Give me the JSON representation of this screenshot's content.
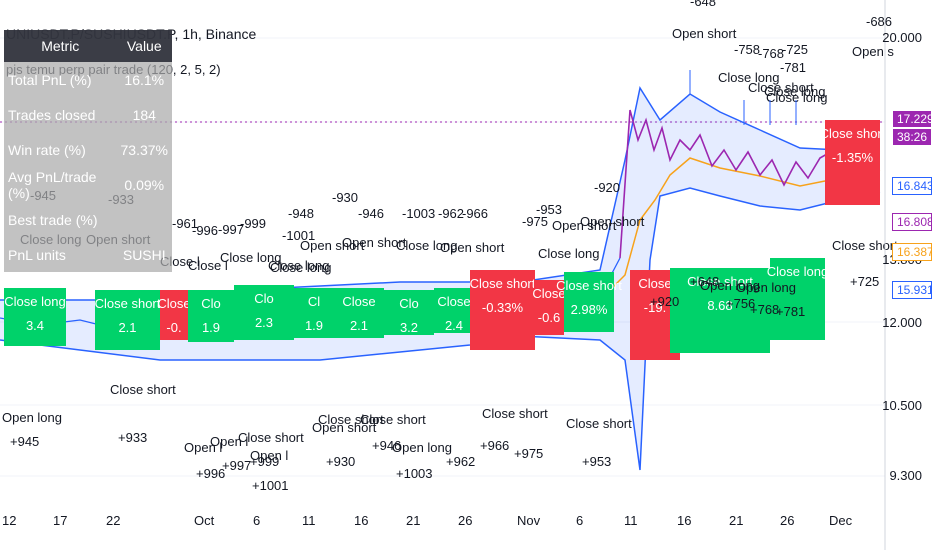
{
  "header": {
    "symbol": "UNIUSDT.P/SUSHIUSDT.P, 1h, Binance",
    "study": "pjs temu perp pair trade (120, 2, 5, 2)"
  },
  "metrics_table": {
    "headers": [
      "Metric",
      "Value"
    ],
    "rows": [
      [
        "Total PnL (%)",
        "16.1%"
      ],
      [
        "Trades closed",
        "184"
      ],
      [
        "Win rate (%)",
        "73.37%"
      ],
      [
        "Avg PnL/trade (%)",
        "0.09%"
      ],
      [
        "Best trade (%)",
        ""
      ],
      [
        "PnL units",
        "SUSHI"
      ]
    ]
  },
  "colors": {
    "win": "#00d26a",
    "loss": "#f23645",
    "band": "#2962ff",
    "price": "#9c27b0",
    "ma": "#f7a21b",
    "arrow_long": "#2962ff",
    "arrow_short": "#e91e63"
  },
  "y_axis": {
    "ticks": [
      "20.000",
      "13.800",
      "12.000",
      "10.500",
      "9.300"
    ],
    "scale": "log"
  },
  "x_axis": {
    "ticks": [
      "12",
      "17",
      "22",
      "Oct",
      "6",
      "11",
      "16",
      "21",
      "26",
      "Nov",
      "6",
      "11",
      "16",
      "21",
      "26",
      "Dec"
    ]
  },
  "price_labels": [
    {
      "text": "17.229",
      "bg": "#9c27b0",
      "fg": "#ffffff"
    },
    {
      "text": "38:26",
      "bg": "#9c27b0",
      "fg": "#ffffff"
    },
    {
      "text": "16.843",
      "bg": "#ffffff",
      "fg": "#2962ff"
    },
    {
      "text": "16.808",
      "bg": "#ffffff",
      "fg": "#9c27b0"
    },
    {
      "text": "16.387",
      "bg": "#ffffff",
      "fg": "#f7a21b"
    },
    {
      "text": "15.931",
      "bg": "#ffffff",
      "fg": "#2962ff"
    }
  ],
  "trade_boxes": [
    {
      "text": "Close long",
      "pnl": "3.4",
      "result": "win"
    },
    {
      "text": "Close short",
      "pnl": "2.1",
      "result": "win"
    },
    {
      "text": "Close",
      "pnl": "-0.",
      "result": "loss"
    },
    {
      "text": "Clo",
      "pnl": "1.9",
      "result": "win"
    },
    {
      "text": "Clo",
      "pnl": "2.3",
      "result": "win"
    },
    {
      "text": "Cl",
      "pnl": "1.9",
      "result": "win"
    },
    {
      "text": "Close",
      "pnl": "2.1",
      "result": "win"
    },
    {
      "text": "Clo",
      "pnl": "3.2",
      "result": "win"
    },
    {
      "text": "Close",
      "pnl": "2.4",
      "result": "win"
    },
    {
      "text": "Close short",
      "pnl": "-0.33%",
      "result": "loss"
    },
    {
      "text": "Close",
      "pnl": "-0.6",
      "result": "loss"
    },
    {
      "text": "Close short",
      "pnl": "2.98%",
      "result": "win"
    },
    {
      "text": "Close",
      "pnl": "-19.",
      "result": "loss"
    },
    {
      "text": "Close short",
      "pnl": "8.68",
      "result": "win"
    },
    {
      "text": "Close long",
      "pnl": "",
      "result": "win"
    },
    {
      "text": "Close short",
      "pnl": "-1.35%",
      "result": "loss"
    }
  ],
  "trade_labels": [
    "Open long",
    "+945",
    "-945",
    "Close long",
    "-933",
    "Open short",
    "Close short",
    "+933",
    "-961",
    "-996",
    "-997",
    "-999",
    "Close l",
    "Close l",
    "Close long",
    "Close long",
    "Open l",
    "Open l",
    "Close short",
    "Open l",
    "+996",
    "+997",
    "+999",
    "+1001",
    "-948",
    "-1001",
    "Open short",
    "Close long",
    "-930",
    "-946",
    "Open short",
    "Open short",
    "-1003",
    "-962",
    "-966",
    "Close long",
    "Open short",
    "Close short",
    "Close short",
    "+930",
    "+946",
    "+1003",
    "+962",
    "Open long",
    "-975",
    "-953",
    "Open short",
    "-920",
    "Open short",
    "Close long",
    "+966",
    "+975",
    "Close short",
    "+953",
    "Close short",
    "-648",
    "Open short",
    "-758",
    "-768",
    "-781",
    "-725",
    "Close long",
    "Close short",
    "Close long",
    "Close long",
    "-686",
    "Open s",
    "Close short",
    "+725",
    "+920",
    "+648",
    "Open long",
    "Open long",
    "+756",
    "+768",
    "+781"
  ]
}
